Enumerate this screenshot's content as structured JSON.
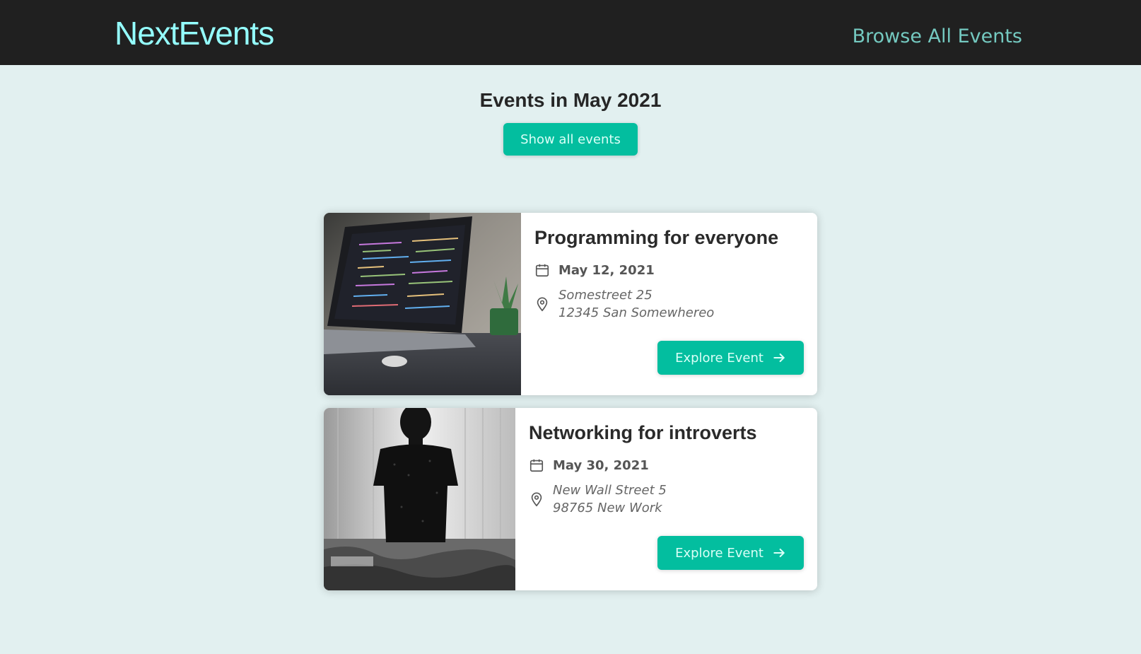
{
  "header": {
    "logo": "NextEvents",
    "nav_link": "Browse All Events"
  },
  "filter": {
    "title": "Events in May 2021",
    "show_all_label": "Show all events"
  },
  "events": [
    {
      "title": "Programming for everyone",
      "date": "May 12, 2021",
      "address_line1": "Somestreet 25",
      "address_line2": "12345 San Somewhereo",
      "button_label": "Explore Event",
      "image_icon": "laptop-code-photo"
    },
    {
      "title": "Networking for introverts",
      "date": "May 30, 2021",
      "address_line1": "New Wall Street 5",
      "address_line2": "98765 New Work",
      "button_label": "Explore Event",
      "image_icon": "person-on-bed-photo"
    }
  ],
  "colors": {
    "header_bg": "#202020",
    "logo": "#94fdfd",
    "nav_link": "#74c9c0",
    "page_bg": "#e2f0f0",
    "accent": "#03be9f"
  }
}
